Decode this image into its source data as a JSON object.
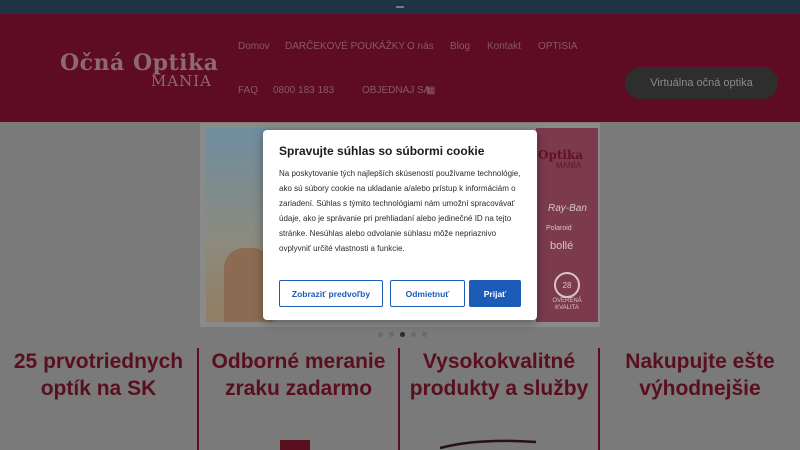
{
  "header": {
    "logo_line1": "Očná Optika",
    "logo_line2": "MANIA",
    "nav": [
      "Domov",
      "DARČEKOVÉ POUKÁŽKY",
      "O nás",
      "Blog",
      "Kontakt",
      "OPTISIA",
      "FAQ",
      "0800 183 183",
      "OBJEDNAJ SA"
    ],
    "cta_label": "Virtuálna očná optika"
  },
  "hero": {
    "brand_line1": "Optika",
    "brand_line2": "MANIA",
    "logos": [
      "Ray-Ban",
      "Polaroid",
      "bollé"
    ],
    "badge_number": "28",
    "badge_text": "OVERENÁ KVALITA",
    "slider_dots": 5,
    "active_dot": 2
  },
  "features": [
    {
      "title": "25 prvotriednych optík na SK"
    },
    {
      "title": "Odborné meranie zraku zadarmo"
    },
    {
      "title": "Vysokokvalitné produkty a služby"
    },
    {
      "title": "Nakupujte ešte výhodnejšie"
    }
  ],
  "cookie": {
    "title": "Spravujte súhlas so súbormi cookie",
    "body": "Na poskytovanie tých najlepších skúseností používame technológie, ako sú súbory cookie na ukladanie a/alebo prístup k informáciám o zariadení. Súhlas s týmito technológiami nám umožní spracovávať údaje, ako je správanie pri prehliadaní alebo jedinečné ID na tejto stránke. Nesúhlas alebo odvolanie súhlasu môže nepriaznivo ovplyvniť určité vlastnosti a funkcie.",
    "btn_preferences": "Zobraziť predvoľby",
    "btn_deny": "Odmietnuť",
    "btn_accept": "Prijať"
  },
  "colors": {
    "accent": "#1c5bb8",
    "header_bg": "#5e0c24",
    "feature_text": "#5a0f1f"
  }
}
